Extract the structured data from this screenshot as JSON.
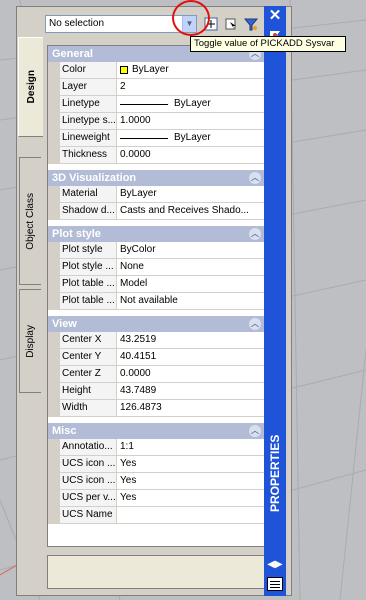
{
  "selector": {
    "value": "No selection"
  },
  "tooltip": "Toggle value of PICKADD Sysvar",
  "side_tabs": [
    "Design",
    "Object Class",
    "Display"
  ],
  "window_title": "PROPERTIES",
  "sections": [
    {
      "title": "General",
      "rows": [
        {
          "name": "Color",
          "value": "ByLayer",
          "glyph": "swatch"
        },
        {
          "name": "Layer",
          "value": "2"
        },
        {
          "name": "Linetype",
          "value": "ByLayer",
          "glyph": "line"
        },
        {
          "name": "Linetype s...",
          "value": "1.0000"
        },
        {
          "name": "Lineweight",
          "value": "ByLayer",
          "glyph": "line"
        },
        {
          "name": "Thickness",
          "value": "0.0000"
        }
      ]
    },
    {
      "title": "3D Visualization",
      "rows": [
        {
          "name": "Material",
          "value": "ByLayer"
        },
        {
          "name": "Shadow d...",
          "value": "Casts and Receives Shado..."
        }
      ]
    },
    {
      "title": "Plot style",
      "rows": [
        {
          "name": "Plot style",
          "value": "ByColor"
        },
        {
          "name": "Plot style ...",
          "value": "None"
        },
        {
          "name": "Plot table ...",
          "value": "Model"
        },
        {
          "name": "Plot table ...",
          "value": "Not available"
        }
      ]
    },
    {
      "title": "View",
      "rows": [
        {
          "name": "Center X",
          "value": "43.2519"
        },
        {
          "name": "Center Y",
          "value": "40.4151"
        },
        {
          "name": "Center Z",
          "value": "0.0000"
        },
        {
          "name": "Height",
          "value": "43.7489"
        },
        {
          "name": "Width",
          "value": "126.4873"
        }
      ]
    },
    {
      "title": "Misc",
      "rows": [
        {
          "name": "Annotatio...",
          "value": "1:1"
        },
        {
          "name": "UCS icon ...",
          "value": "Yes"
        },
        {
          "name": "UCS icon ...",
          "value": "Yes"
        },
        {
          "name": "UCS per v...",
          "value": "Yes"
        },
        {
          "name": "UCS Name",
          "value": ""
        }
      ]
    }
  ],
  "colors": {
    "title_bar": "#1f53d8",
    "section_header": "#b2bcd6",
    "highlight_circle": "#e01010",
    "color_swatch": "#ffff00"
  },
  "icons": [
    "dropdown-arrow-icon",
    "pickadd-toggle-icon",
    "select-objects-icon",
    "quick-select-icon",
    "close-icon",
    "autohide-icon",
    "properties-settings-icon",
    "palette-menu-icon"
  ]
}
